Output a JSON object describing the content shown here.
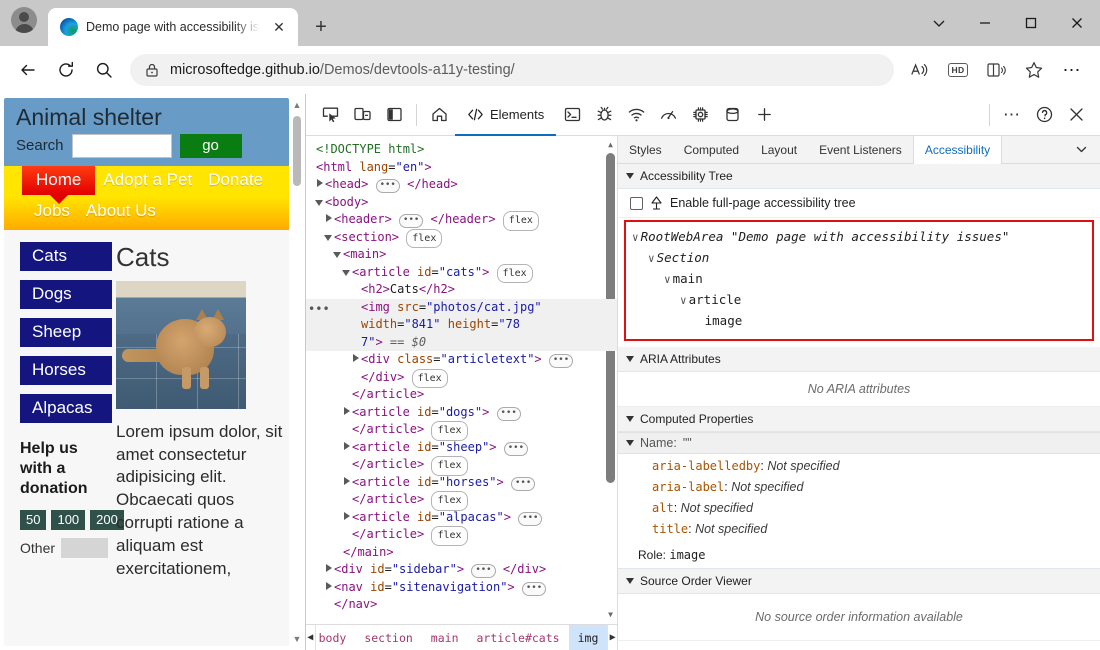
{
  "window": {
    "controls": {
      "dropdown": "chevron-down",
      "minimize": "minimize",
      "maximize": "maximize",
      "close": "close"
    }
  },
  "browser": {
    "tab": {
      "title": "Demo page with accessibility issu",
      "close_label": "✕"
    },
    "newtab_label": "+",
    "toolbar": {
      "back": "back-arrow",
      "refresh": "refresh",
      "search": "search",
      "lock": "lock",
      "url_bold": "microsoftedge.github.io",
      "url_rest": "/Demos/devtools-a11y-testing/",
      "read_aloud": "A",
      "hd_badge": "HD",
      "immersive_reader": "immersive-reader",
      "favorite": "☆",
      "settings": "⋯"
    }
  },
  "webpage": {
    "title": "Animal shelter",
    "search_label": "Search",
    "search_value": "",
    "go_label": "go",
    "nav_primary": [
      "Home",
      "Adopt a Pet",
      "Donate"
    ],
    "nav_secondary": [
      "Jobs",
      "About Us"
    ],
    "categories": [
      "Cats",
      "Dogs",
      "Sheep",
      "Horses",
      "Alpacas"
    ],
    "help_title": "Help us with a donation",
    "donation_amounts": [
      "50",
      "100",
      "200"
    ],
    "other_label": "Other",
    "other_value": "",
    "main_heading": "Cats",
    "main_text": "Lorem ipsum dolor, sit amet consectetur adipisicing elit. Obcaecati quos corrupti ratione a aliquam est exercitationem,"
  },
  "devtools": {
    "toolbar_icons": [
      "inspect-element-icon",
      "device-emulation-icon",
      "dock-side-icon",
      "home-icon",
      "console-icon",
      "sources-bug-icon",
      "network-wifi-icon",
      "performance-gauge-icon",
      "memory-chip-icon",
      "application-database-icon",
      "add-panel-icon",
      "more-tools-icon",
      "help-icon",
      "close-devtools-icon"
    ],
    "active_tab": "Elements",
    "dom_lines": [
      {
        "indent": 0,
        "tri": "",
        "html": "<span class=\"cm\">&lt;!DOCTYPE html&gt;</span>"
      },
      {
        "indent": 0,
        "tri": "",
        "html": "<span class=\"tw\">&lt;html</span> <span class=\"at\">lang</span>=<span class=\"av\">\"en\"</span><span class=\"tw\">&gt;</span>"
      },
      {
        "indent": 1,
        "tri": "closed",
        "html": "<span class=\"tw\">&lt;head&gt;</span> <span class=\"dots\">•••</span> <span class=\"tw\">&lt;/head&gt;</span>"
      },
      {
        "indent": 1,
        "tri": "open",
        "html": "<span class=\"tw\">&lt;body&gt;</span>"
      },
      {
        "indent": 2,
        "tri": "closed",
        "html": "<span class=\"tw\">&lt;header&gt;</span> <span class=\"dots\">•••</span> <span class=\"tw\">&lt;/header&gt;</span> <span class=\"badge-flex\">flex</span>"
      },
      {
        "indent": 2,
        "tri": "open",
        "html": "<span class=\"tw\">&lt;section&gt;</span> <span class=\"badge-flex\">flex</span>"
      },
      {
        "indent": 3,
        "tri": "open",
        "html": "<span class=\"tw\">&lt;main&gt;</span>"
      },
      {
        "indent": 4,
        "tri": "open",
        "html": "<span class=\"tw\">&lt;article</span> <span class=\"at\">id</span>=<span class=\"av\">\"cats\"</span><span class=\"tw\">&gt;</span> <span class=\"badge-flex\">flex</span>"
      },
      {
        "indent": 5,
        "tri": "",
        "html": "<span class=\"tw\">&lt;h2&gt;</span><span class=\"tx\">Cats</span><span class=\"tw\">&lt;/h2&gt;</span>"
      },
      {
        "indent": 5,
        "tri": "",
        "sel": true,
        "rowdots": true,
        "html": "<span class=\"tw\">&lt;img</span> <span class=\"at\">src</span>=<span class=\"av\">\"photos/cat.jpg\"</span>"
      },
      {
        "indent": 5,
        "tri": "",
        "sel": true,
        "html": "<span class=\"at\">width</span>=<span class=\"av\">\"841\"</span> <span class=\"at\">height</span>=<span class=\"av\">\"78</span>"
      },
      {
        "indent": 5,
        "tri": "",
        "sel": true,
        "html": "<span class=\"av\">7\"</span><span class=\"tw\">&gt;</span> <span class=\"eq\">== $0</span>"
      },
      {
        "indent": 5,
        "tri": "closed",
        "html": "<span class=\"tw\">&lt;div</span> <span class=\"at\">class</span>=<span class=\"av\">\"articletext\"</span><span class=\"tw\">&gt;</span> <span class=\"dots\">•••</span>"
      },
      {
        "indent": 5,
        "tri": "",
        "html": "<span class=\"tw\">&lt;/div&gt;</span> <span class=\"badge-flex\">flex</span>"
      },
      {
        "indent": 4,
        "tri": "",
        "html": "<span class=\"tw\">&lt;/article&gt;</span>"
      },
      {
        "indent": 4,
        "tri": "closed",
        "html": "<span class=\"tw\">&lt;article</span> <span class=\"at\">id</span>=<span class=\"av\">\"dogs\"</span><span class=\"tw\">&gt;</span> <span class=\"dots\">•••</span>"
      },
      {
        "indent": 4,
        "tri": "",
        "html": "<span class=\"tw\">&lt;/article&gt;</span> <span class=\"badge-flex\">flex</span>"
      },
      {
        "indent": 4,
        "tri": "closed",
        "html": "<span class=\"tw\">&lt;article</span> <span class=\"at\">id</span>=<span class=\"av\">\"sheep\"</span><span class=\"tw\">&gt;</span> <span class=\"dots\">•••</span>"
      },
      {
        "indent": 4,
        "tri": "",
        "html": "<span class=\"tw\">&lt;/article&gt;</span> <span class=\"badge-flex\">flex</span>"
      },
      {
        "indent": 4,
        "tri": "closed",
        "html": "<span class=\"tw\">&lt;article</span> <span class=\"at\">id</span>=<span class=\"av\">\"horses\"</span><span class=\"tw\">&gt;</span> <span class=\"dots\">•••</span>"
      },
      {
        "indent": 4,
        "tri": "",
        "html": "<span class=\"tw\">&lt;/article&gt;</span> <span class=\"badge-flex\">flex</span>"
      },
      {
        "indent": 4,
        "tri": "closed",
        "html": "<span class=\"tw\">&lt;article</span> <span class=\"at\">id</span>=<span class=\"av\">\"alpacas\"</span><span class=\"tw\">&gt;</span> <span class=\"dots\">•••</span>"
      },
      {
        "indent": 4,
        "tri": "",
        "html": "<span class=\"tw\">&lt;/article&gt;</span> <span class=\"badge-flex\">flex</span>"
      },
      {
        "indent": 3,
        "tri": "",
        "html": "<span class=\"tw\">&lt;/main&gt;</span>"
      },
      {
        "indent": 2,
        "tri": "closed",
        "html": "<span class=\"tw\">&lt;div</span> <span class=\"at\">id</span>=<span class=\"av\">\"sidebar\"</span><span class=\"tw\">&gt;</span> <span class=\"dots\">•••</span> <span class=\"tw\">&lt;/div&gt;</span>"
      },
      {
        "indent": 2,
        "tri": "closed",
        "html": "<span class=\"tw\">&lt;nav</span> <span class=\"at\">id</span>=<span class=\"av\">\"sitenavigation\"</span><span class=\"tw\">&gt;</span> <span class=\"dots\">•••</span>"
      },
      {
        "indent": 2,
        "tri": "",
        "html": "<span class=\"tw\">&lt;/nav&gt;</span>"
      }
    ],
    "breadcrumb": [
      "body",
      "section",
      "main",
      "article#cats",
      "img"
    ],
    "breadcrumb_active": "img",
    "sidebar_tabs": [
      "Styles",
      "Computed",
      "Layout",
      "Event Listeners",
      "Accessibility"
    ],
    "sidebar_active_tab": "Accessibility",
    "sections": {
      "accessibility_tree": {
        "title": "Accessibility Tree",
        "checkbox_label": "Enable full-page accessibility tree",
        "checkbox_checked": false,
        "tree": [
          {
            "depth": 0,
            "chevron": true,
            "role": "RootWebArea",
            "name": "\"Demo page with accessibility issues\"",
            "italic": true
          },
          {
            "depth": 1,
            "chevron": true,
            "role": "Section",
            "name": "",
            "italic": true
          },
          {
            "depth": 2,
            "chevron": true,
            "role": "main",
            "name": "",
            "italic": false
          },
          {
            "depth": 3,
            "chevron": true,
            "role": "article",
            "name": "",
            "italic": false
          },
          {
            "depth": 4,
            "chevron": false,
            "role": "image",
            "name": "",
            "italic": false
          }
        ],
        "highlight_color": "#e01010"
      },
      "aria_attributes": {
        "title": "ARIA Attributes",
        "empty_text": "No ARIA attributes"
      },
      "computed_properties": {
        "title": "Computed Properties",
        "name_label": "Name:",
        "name_value": "\"\"",
        "properties": [
          {
            "key": "aria-labelledby",
            "value": "Not specified"
          },
          {
            "key": "aria-label",
            "value": "Not specified"
          },
          {
            "key": "alt",
            "value": "Not specified"
          },
          {
            "key": "title",
            "value": "Not specified"
          }
        ],
        "role_label": "Role:",
        "role_value": "image"
      },
      "source_order_viewer": {
        "title": "Source Order Viewer",
        "empty_text": "No source order information available"
      }
    }
  },
  "colors": {
    "page_header_blue": "#699bc7",
    "nav_yellow": "#ffe500",
    "nav_orange": "#ffaa00",
    "home_red": "#e20000",
    "go_green": "#0a7d12",
    "category_navy": "#151580",
    "donate_green": "#2f5149",
    "devtools_accent": "#0f6cbd",
    "highlight_red": "#e01010"
  }
}
